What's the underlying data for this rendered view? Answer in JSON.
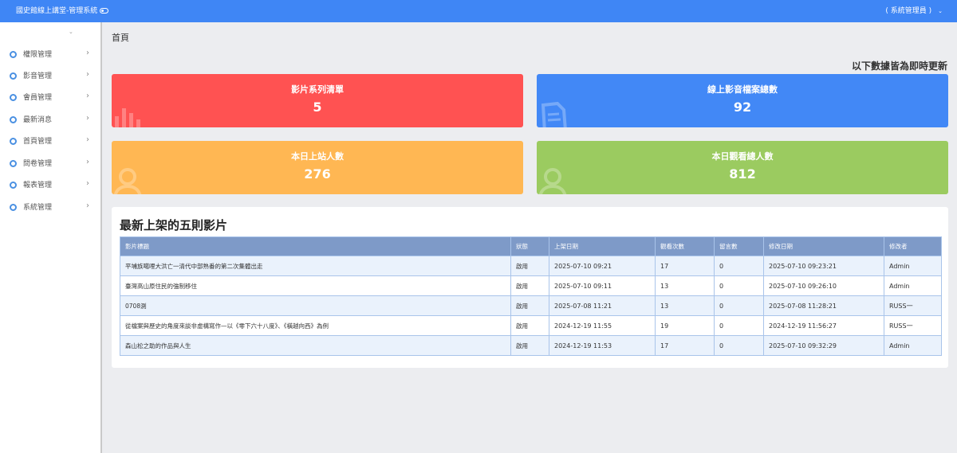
{
  "header": {
    "app_title": "國史館線上講堂-管理系統",
    "user_label": "( 系統管理員 )"
  },
  "sidebar": {
    "items": [
      {
        "label": "權限管理"
      },
      {
        "label": "影音管理"
      },
      {
        "label": "會員管理"
      },
      {
        "label": "最新消息"
      },
      {
        "label": "首頁管理"
      },
      {
        "label": "問卷管理"
      },
      {
        "label": "報表管理"
      },
      {
        "label": "系統管理"
      }
    ]
  },
  "breadcrumb": "首頁",
  "realtime_note": "以下數據皆為即時更新",
  "stats": {
    "series_label": "影片系列清單",
    "series_value": "5",
    "files_label": "線上影音檔案總數",
    "files_value": "92",
    "visitors_label": "本日上站人數",
    "visitors_value": "276",
    "viewers_label": "本日觀看總人數",
    "viewers_value": "812"
  },
  "latest": {
    "title": "最新上架的五則影片",
    "columns": [
      "影片標題",
      "狀態",
      "上架日期",
      "觀看次數",
      "留言數",
      "修改日期",
      "修改者"
    ],
    "rows": [
      {
        "title": "平埔族噶哩大洪亡一清代中部熟番的第二次集體出走",
        "status": "啟用",
        "published": "2025-07-10 09:21",
        "views": "17",
        "comments": "0",
        "modified": "2025-07-10 09:23:21",
        "editor": "Admin"
      },
      {
        "title": "臺灣高山原住民的強制移住",
        "status": "啟用",
        "published": "2025-07-10 09:11",
        "views": "13",
        "comments": "0",
        "modified": "2025-07-10 09:26:10",
        "editor": "Admin"
      },
      {
        "title": "0708測",
        "status": "啟用",
        "published": "2025-07-08 11:21",
        "views": "13",
        "comments": "0",
        "modified": "2025-07-08 11:28:21",
        "editor": "RUSS一"
      },
      {
        "title": "從檔案與歷史的角度來談非虛構寫作—以《零下六十八度》、《橫越向西》為例",
        "status": "啟用",
        "published": "2024-12-19 11:55",
        "views": "19",
        "comments": "0",
        "modified": "2024-12-19 11:56:27",
        "editor": "RUSS一"
      },
      {
        "title": "森山松之助的作品與人生",
        "status": "啟用",
        "published": "2024-12-19 11:53",
        "views": "17",
        "comments": "0",
        "modified": "2025-07-10 09:32:29",
        "editor": "Admin"
      }
    ]
  },
  "colors": {
    "topbar": "#3f86f5",
    "card_red": "#ff5252",
    "card_blue": "#4288f6",
    "card_orange": "#ffb753",
    "card_green": "#9bcb60",
    "table_header": "#7e9ac8"
  }
}
